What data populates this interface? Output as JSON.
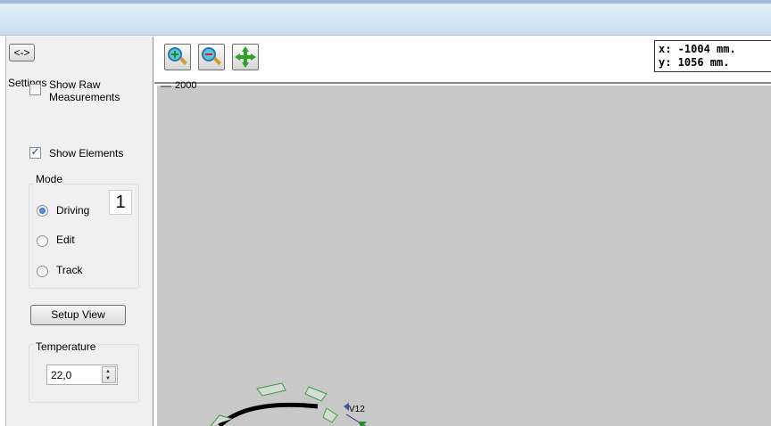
{
  "toggle_button": {
    "label": "<->"
  },
  "settings": {
    "legend": "Settings",
    "show_raw": {
      "label_line1": "Show Raw",
      "label_line2": "Measurements",
      "checked": false
    },
    "show_elements": {
      "label": "Show Elements",
      "checked": true
    },
    "mode": {
      "legend": "Mode",
      "options": [
        {
          "label": "Driving",
          "selected": true
        },
        {
          "label": "Edit",
          "selected": false
        },
        {
          "label": "Track",
          "selected": false
        }
      ]
    },
    "callout_number": "1",
    "setup_view": {
      "label": "Setup View"
    },
    "temperature": {
      "legend": "Temperature",
      "value": "22,0"
    }
  },
  "toolbar": {
    "tools": [
      {
        "name": "zoom-in-icon"
      },
      {
        "name": "zoom-out-icon"
      },
      {
        "name": "fit-view-icon"
      }
    ]
  },
  "coordinates": {
    "x": "x: -1004 mm.",
    "y": "y: 1056 mm."
  },
  "map": {
    "axis_label": "2000",
    "element_label": "V12"
  },
  "colors": {
    "canvas": "#c8c8c8",
    "track": "#000000",
    "sector_outline": "#3b9c3b"
  }
}
